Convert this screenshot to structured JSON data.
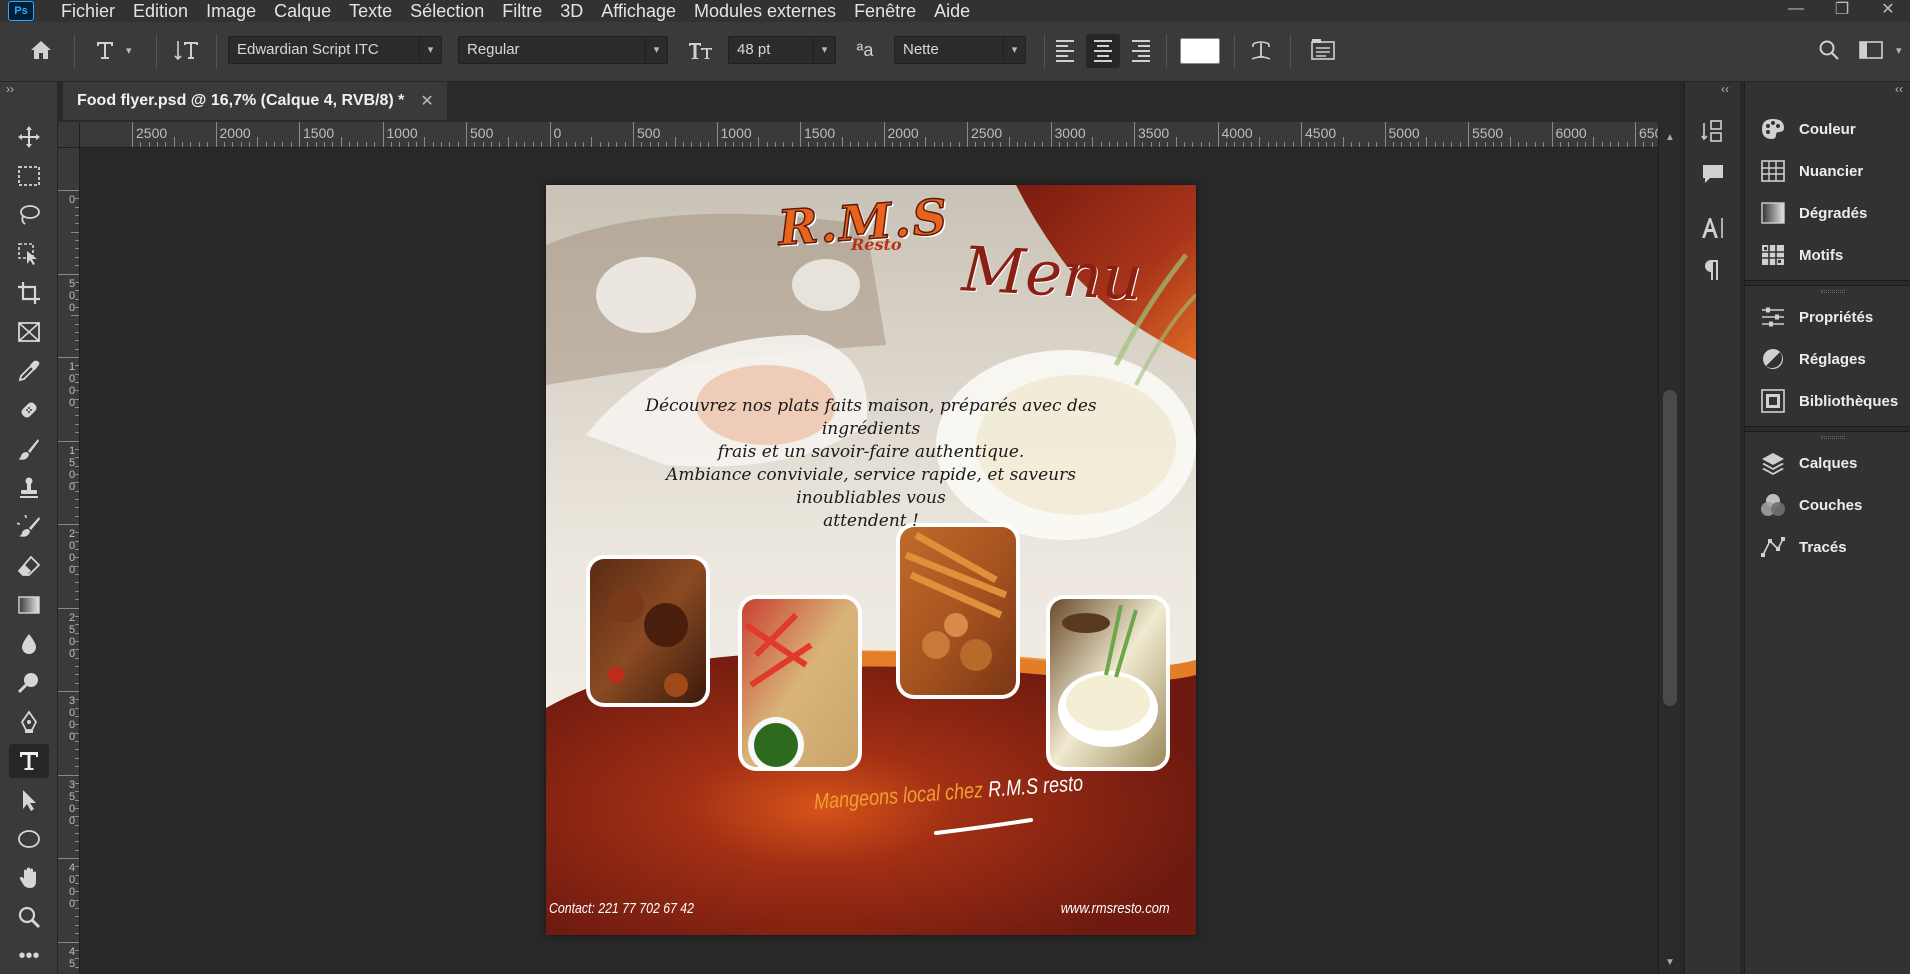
{
  "app": {
    "logo": "Ps",
    "menu": [
      "Fichier",
      "Edition",
      "Image",
      "Calque",
      "Texte",
      "Sélection",
      "Filtre",
      "3D",
      "Affichage",
      "Modules externes",
      "Fenêtre",
      "Aide"
    ],
    "window_controls": {
      "minimize": "—",
      "restore": "❐",
      "close": "✕"
    }
  },
  "options": {
    "font_family": "Edwardian Script ITC",
    "font_style": "Regular",
    "font_size": "48 pt",
    "antialias_icon": "ªa",
    "antialias": "Nette",
    "text_color": "#ffffff"
  },
  "document": {
    "tab_title": "Food flyer.psd @ 16,7% (Calque 4, RVB/8) *",
    "close": "✕"
  },
  "ruler": {
    "h_labels": [
      "2500",
      "2000",
      "1500",
      "1000",
      "500",
      "0",
      "500",
      "1000",
      "1500",
      "2000",
      "2500",
      "3000",
      "3500",
      "4000",
      "4500",
      "5000",
      "5500",
      "6000",
      "650"
    ],
    "v_labels": [
      [
        "0"
      ],
      [
        "5",
        "0",
        "0"
      ],
      [
        "1",
        "0",
        "0",
        "0"
      ],
      [
        "1",
        "5",
        "0",
        "0"
      ],
      [
        "2",
        "0",
        "0",
        "0"
      ],
      [
        "2",
        "5",
        "0",
        "0"
      ],
      [
        "3",
        "0",
        "0",
        "0"
      ],
      [
        "3",
        "5",
        "0",
        "0"
      ],
      [
        "4",
        "0",
        "0",
        "0"
      ],
      [
        "4",
        "5"
      ]
    ]
  },
  "flyer": {
    "logo": "R.M.S",
    "logo_sub": "Resto",
    "menu_title": "Menu",
    "tagline_lines": [
      "Découvrez nos plats faits maison, préparés avec des ingrédients",
      "frais et un savoir-faire authentique.",
      "Ambiance conviviale, service rapide, et saveurs inoubliables vous",
      "attendent !"
    ],
    "slogan_a": "Mangeons local chez",
    "slogan_b": "R.M.S resto",
    "contact": "Contact: 221 77 702 67 42",
    "website": "www.rmsresto.com",
    "colors": {
      "maroon": "#7a1c10",
      "orange": "#e8641e",
      "accent_gold": "#f0a030"
    }
  },
  "panels": [
    {
      "label": "Couleur",
      "icon": "palette-icon"
    },
    {
      "label": "Nuancier",
      "icon": "swatches-icon"
    },
    {
      "label": "Dégradés",
      "icon": "gradient-icon"
    },
    {
      "label": "Motifs",
      "icon": "patterns-icon"
    },
    {
      "label": "Propriétés",
      "icon": "properties-icon"
    },
    {
      "label": "Réglages",
      "icon": "adjustments-icon"
    },
    {
      "label": "Bibliothèques",
      "icon": "libraries-icon"
    },
    {
      "label": "Calques",
      "icon": "layers-icon"
    },
    {
      "label": "Couches",
      "icon": "channels-icon"
    },
    {
      "label": "Tracés",
      "icon": "paths-icon"
    }
  ],
  "dock": {
    "collapse": "‹‹",
    "expand": "››"
  }
}
